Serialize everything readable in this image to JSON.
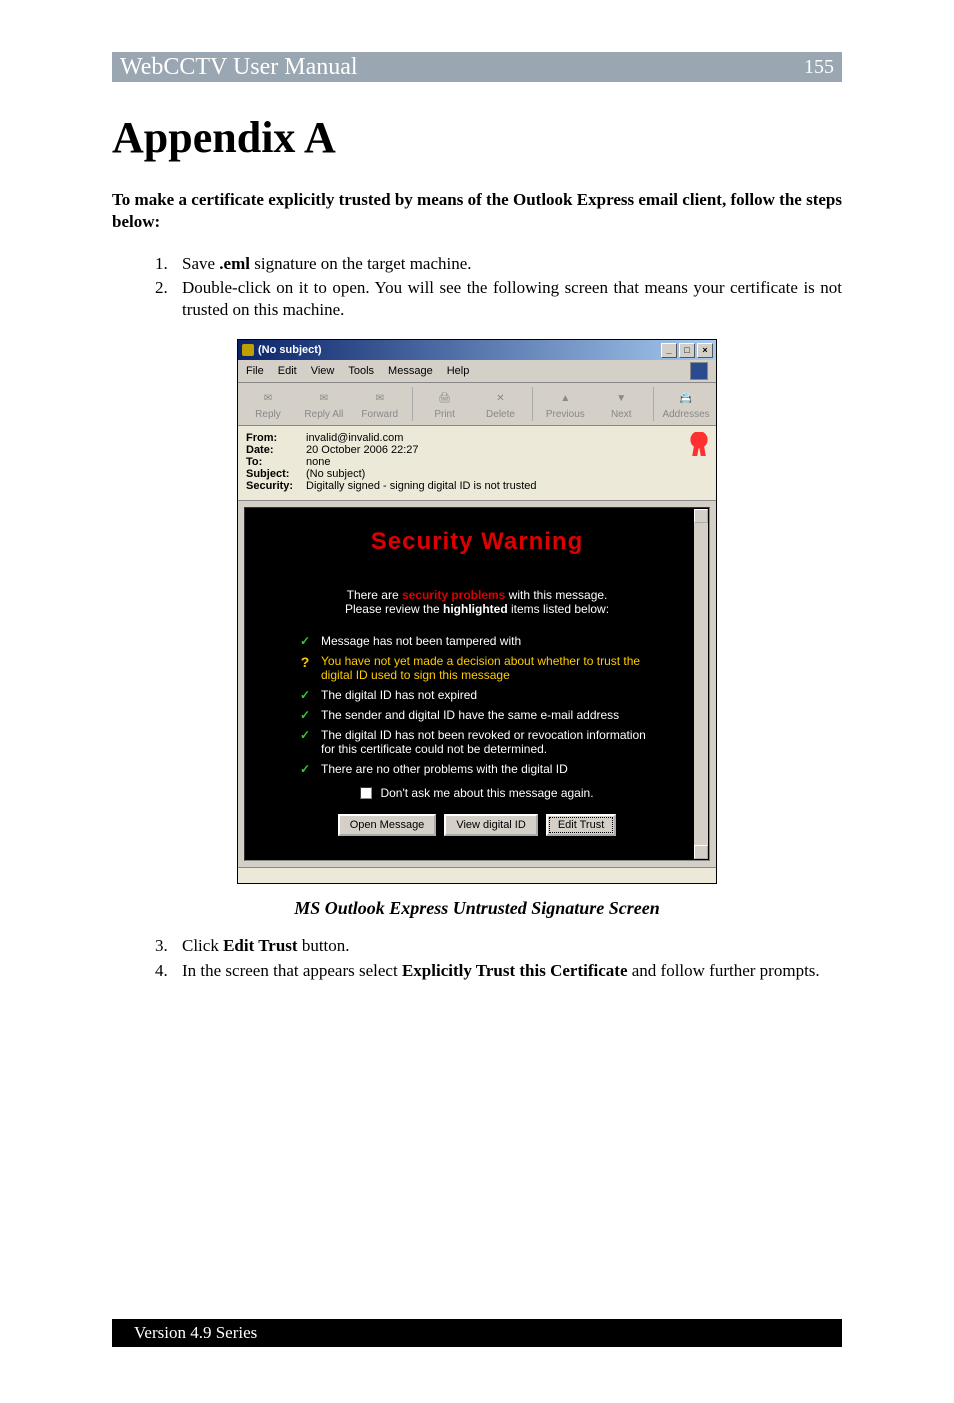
{
  "header": {
    "title": "WebCCTV User Manual",
    "page": "155"
  },
  "appendix_title": "Appendix A",
  "intro_prefix": "To make a certificate explicitly trusted by means of the Outlook Express email client, follow the steps below:",
  "step1_pre": "Save ",
  "step1_bold": ".eml",
  "step1_post": " signature on the target machine.",
  "step2": "Double-click on it to open. You will see the following screen that means your certificate is not trusted on this machine.",
  "dialog": {
    "title": "(No subject)",
    "min": "_",
    "max": "□",
    "close": "×",
    "menu": {
      "file": "File",
      "edit": "Edit",
      "view": "View",
      "tools": "Tools",
      "message": "Message",
      "help": "Help"
    },
    "toolbar": {
      "reply": "Reply",
      "reply_all": "Reply All",
      "forward": "Forward",
      "print": "Print",
      "delete": "Delete",
      "previous": "Previous",
      "next": "Next",
      "addresses": "Addresses"
    },
    "headers": {
      "from_l": "From:",
      "from_v": "invalid@invalid.com",
      "date_l": "Date:",
      "date_v": "20 October 2006 22:27",
      "to_l": "To:",
      "to_v": "none",
      "subject_l": "Subject:",
      "subject_v": "(No subject)",
      "security_l": "Security:",
      "security_v": "Digitally signed - signing digital ID is not trusted"
    },
    "warning": {
      "title": "Security Warning",
      "intro_pre": "There are ",
      "intro_sp": "security problems",
      "intro_mid": " with this message.",
      "intro_line2_pre": "Please review the ",
      "intro_hl": "highlighted",
      "intro_line2_post": " items listed below:",
      "items": {
        "i1": "Message has not been tampered with",
        "i2": "You have not yet made a decision about whether to trust the digital ID used to sign this message",
        "i3": "The digital ID has not expired",
        "i4": "The sender and digital ID have the same e-mail address",
        "i5": "The digital ID has not been revoked or revocation information for this certificate could not be determined.",
        "i6": "There are no other problems with the digital ID"
      },
      "dont_ask": "Don't ask me about this message again.",
      "btn_open": "Open Message",
      "btn_view": "View digital ID",
      "btn_edit": "Edit Trust"
    }
  },
  "caption": "MS Outlook Express Untrusted Signature Screen",
  "step3_pre": "Click ",
  "step3_bold": "Edit Trust",
  "step3_post": " button.",
  "step4_pre": "In the screen that appears select ",
  "step4_bold": "Explicitly Trust this Certificate",
  "step4_post": " and follow further prompts.",
  "footer": "Version 4.9 Series"
}
